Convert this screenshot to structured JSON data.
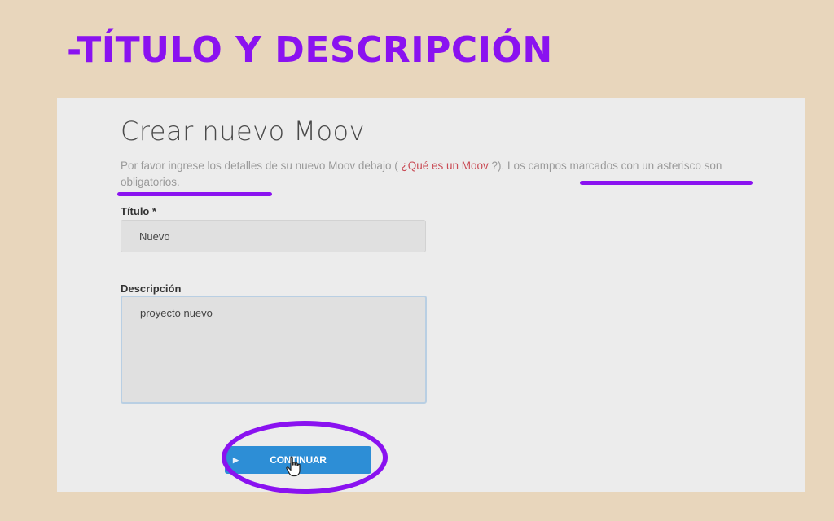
{
  "slide": {
    "title": "-TÍTULO Y DESCRIPCIÓN"
  },
  "form": {
    "title": "Crear nuevo Moov",
    "intro_before": "Por favor ingrese los detalles de su nuevo Moov debajo ( ",
    "intro_link": "¿Qué es un Moov",
    "intro_after": " ?). Los campos marcados con un asterisco son obligatorios.",
    "title_label": "Título *",
    "title_value": "Nuevo",
    "description_label": "Descripción",
    "description_value": "proyecto nuevo",
    "continue_label": "CONTINUAR"
  },
  "icons": {
    "button_arrow": "arrow-right-icon",
    "cursor": "hand-pointer-icon"
  },
  "colors": {
    "slide_background": "#e8d6bc",
    "slide_title": "#8a12f0",
    "annotation": "#8a12f0",
    "link": "#c94b55",
    "button": "#2d8ed6"
  }
}
